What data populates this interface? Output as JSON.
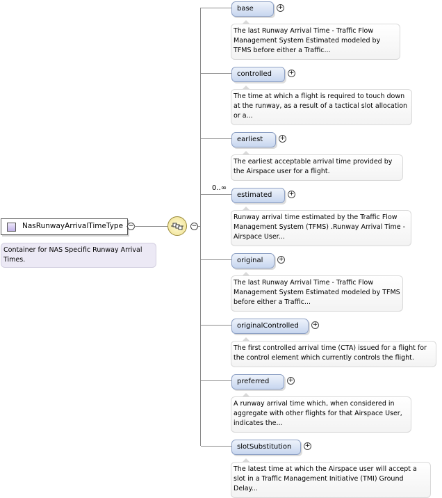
{
  "root": {
    "name": "NasRunwayArrivalTimeType",
    "doc": "Container for NAS Specific Runway Arrival Times."
  },
  "multiplicity_label": "0..∞",
  "elements": [
    {
      "name": "base",
      "doc": "The last Runway Arrival Time - Traffic Flow Management System Estimated modeled by TFMS before either a Traffic..."
    },
    {
      "name": "controlled",
      "doc": "The time at which a flight is required to touch down at the runway, as a result of a tactical slot allocation or a..."
    },
    {
      "name": "earliest",
      "doc": "The earliest acceptable arrival time provided by the Airspace user for a flight."
    },
    {
      "name": "estimated",
      "doc": "Runway arrival time estimated by the Traffic Flow Management System (TFMS) .Runway Arrival Time - Airspace User..."
    },
    {
      "name": "original",
      "doc": "The last Runway Arrival Time - Traffic Flow Management System Estimated modeled by TFMS before either a Traffic..."
    },
    {
      "name": "originalControlled",
      "doc": "The first controlled arrival time (CTA) issued for a flight for the control element which currently controls the flight."
    },
    {
      "name": "preferred",
      "doc": "A runway arrival time which, when considered in aggregate with other flights for that Airspace User, indicates the..."
    },
    {
      "name": "slotSubstitution",
      "doc": "The latest time at which the Airspace user will accept a slot in a Traffic Management Initiative (TMI) Ground Delay..."
    }
  ],
  "icons": {
    "expand": "plus-circle-icon",
    "collapse": "minus-circle-icon",
    "compositor": "sequence-compositor-icon",
    "type": "complex-type-icon"
  }
}
